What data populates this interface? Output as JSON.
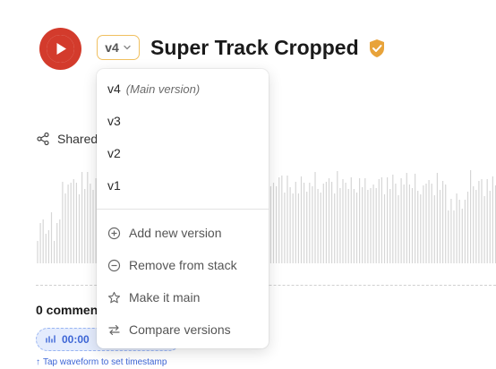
{
  "header": {
    "version_value": "v4",
    "title": "Super Track Cropped"
  },
  "share": {
    "label": "Shared"
  },
  "comments": {
    "count_label": "0 comments",
    "timestamp": "00:00",
    "hint": "Tap waveform to set timestamp"
  },
  "dropdown": {
    "versions": [
      {
        "label": "v4",
        "note": "(Main version)"
      },
      {
        "label": "v3"
      },
      {
        "label": "v2"
      },
      {
        "label": "v1"
      }
    ],
    "actions": [
      {
        "label": "Add new version",
        "icon": "plus-circle-icon"
      },
      {
        "label": "Remove from stack",
        "icon": "minus-circle-icon"
      },
      {
        "label": "Make it main",
        "icon": "star-icon"
      },
      {
        "label": "Compare versions",
        "icon": "swap-arrows-icon"
      }
    ]
  },
  "colors": {
    "play": "#d33b2c",
    "badge": "#e8a33a",
    "accent": "#3d66d6",
    "select_border": "#f0c060"
  }
}
